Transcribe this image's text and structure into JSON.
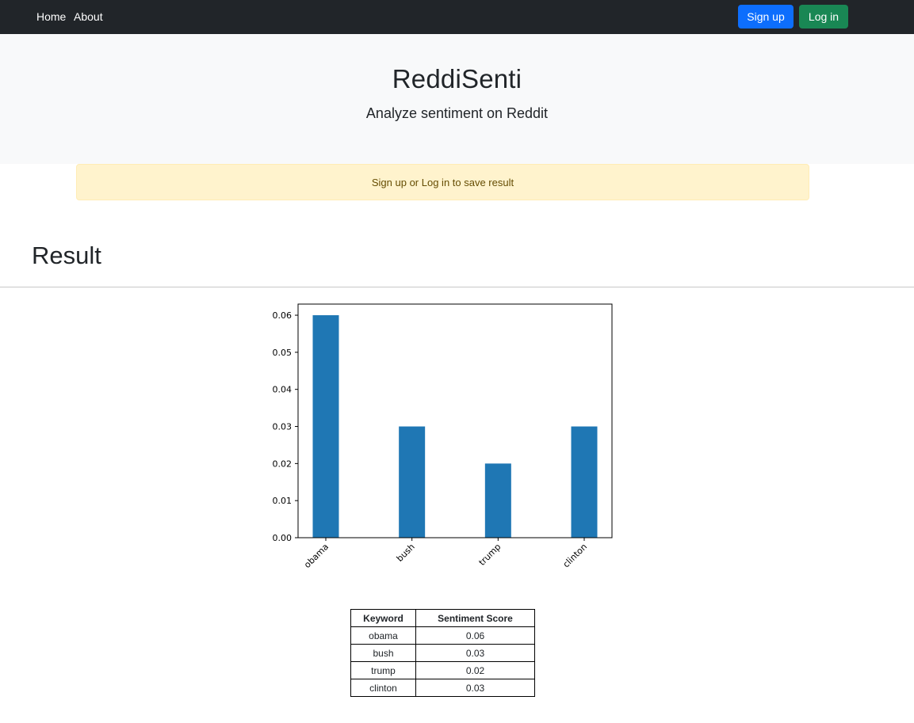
{
  "nav": {
    "links": [
      "Home",
      "About"
    ],
    "signup_label": "Sign up",
    "login_label": "Log in"
  },
  "hero": {
    "title": "ReddiSenti",
    "subtitle": "Analyze sentiment on Reddit"
  },
  "alert": {
    "message": "Sign up or Log in to save result"
  },
  "result": {
    "heading": "Result"
  },
  "chart_data": {
    "type": "bar",
    "categories": [
      "obama",
      "bush",
      "trump",
      "clinton"
    ],
    "values": [
      0.06,
      0.03,
      0.02,
      0.03
    ],
    "ylim": [
      0,
      0.063
    ],
    "yticks": [
      "0.00",
      "0.01",
      "0.02",
      "0.03",
      "0.04",
      "0.05",
      "0.06"
    ],
    "title": "",
    "xlabel": "",
    "ylabel": "",
    "grid": false,
    "bar_color": "#1f77b4"
  },
  "table": {
    "headers": [
      "Keyword",
      "Sentiment Score"
    ],
    "rows": [
      [
        "obama",
        "0.06"
      ],
      [
        "bush",
        "0.03"
      ],
      [
        "trump",
        "0.02"
      ],
      [
        "clinton",
        "0.03"
      ]
    ]
  },
  "colors": {
    "navbar": "#212529",
    "signup": "#0d6efd",
    "login": "#198754",
    "hero_bg": "#f8f9fa",
    "alert_bg": "#fff3cd",
    "alert_text": "#664d03"
  }
}
